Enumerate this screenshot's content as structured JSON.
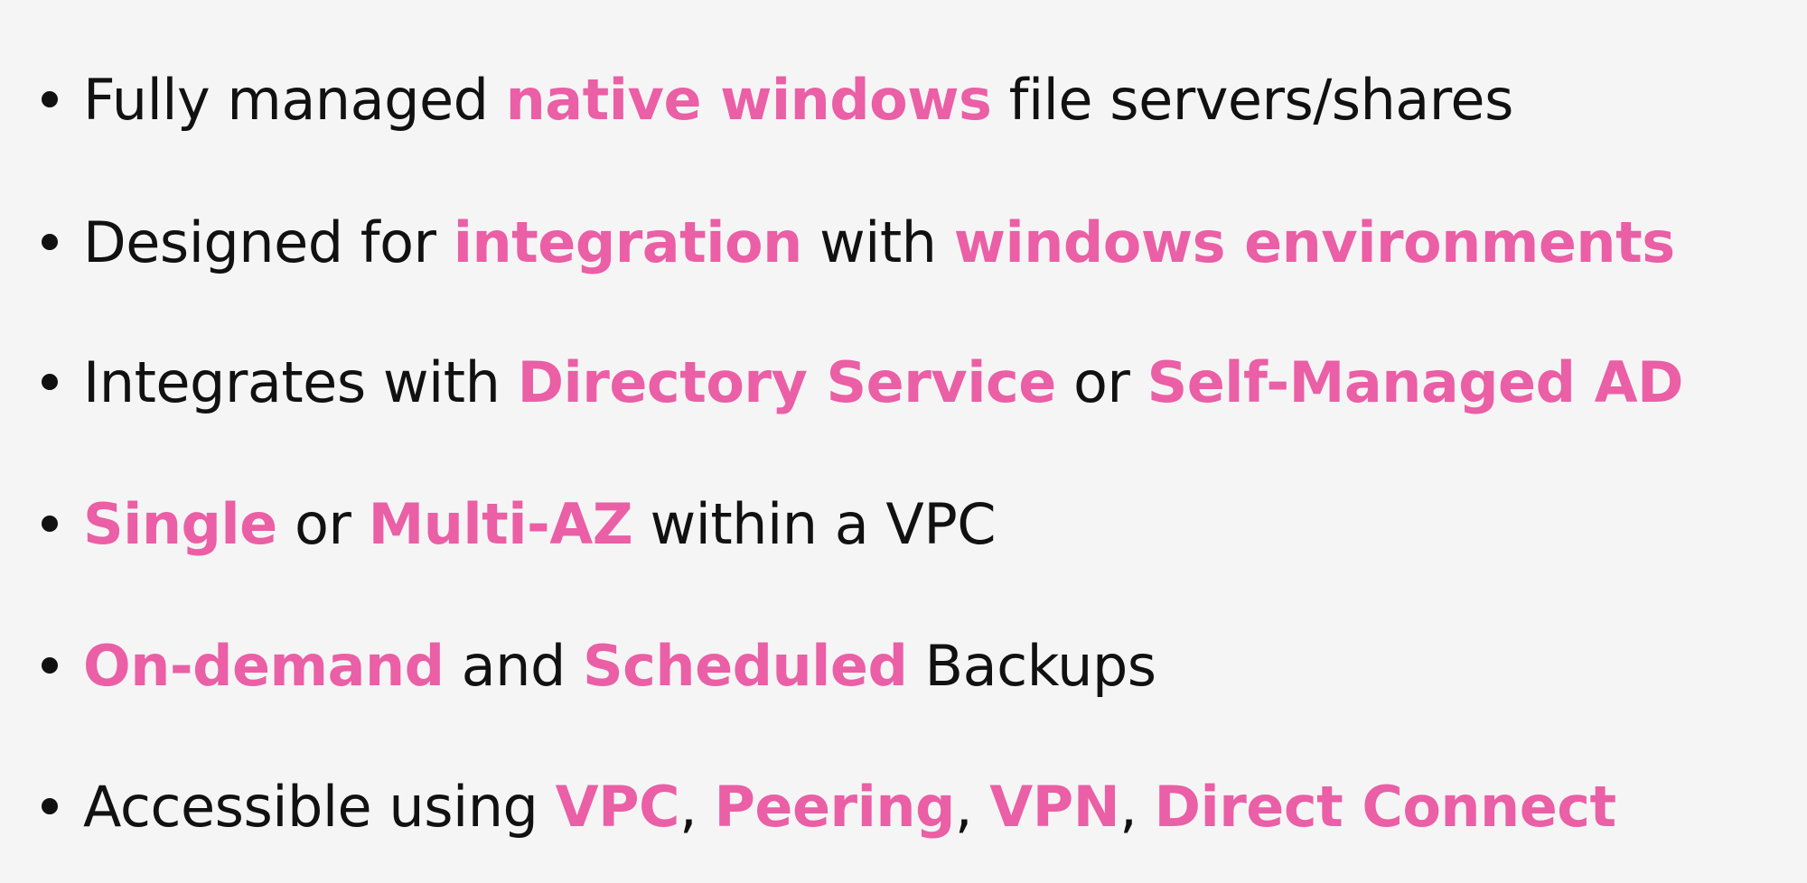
{
  "colors": {
    "background": "#f5f5f5",
    "text": "#111111",
    "highlight": "#ea5fa5"
  },
  "bullets": [
    {
      "segments": [
        {
          "text": "Fully managed ",
          "highlight": false
        },
        {
          "text": "native windows",
          "highlight": true
        },
        {
          "text": " file servers/shares",
          "highlight": false
        }
      ]
    },
    {
      "segments": [
        {
          "text": "Designed for ",
          "highlight": false
        },
        {
          "text": "integration",
          "highlight": true
        },
        {
          "text": " with ",
          "highlight": false
        },
        {
          "text": "windows environments",
          "highlight": true
        }
      ]
    },
    {
      "segments": [
        {
          "text": "Integrates with ",
          "highlight": false
        },
        {
          "text": "Directory Service",
          "highlight": true
        },
        {
          "text": " or ",
          "highlight": false
        },
        {
          "text": "Self-Managed AD",
          "highlight": true
        }
      ]
    },
    {
      "segments": [
        {
          "text": "Single",
          "highlight": true
        },
        {
          "text": " or ",
          "highlight": false
        },
        {
          "text": "Multi-AZ",
          "highlight": true
        },
        {
          "text": " within a VPC",
          "highlight": false
        }
      ]
    },
    {
      "segments": [
        {
          "text": "On-demand",
          "highlight": true
        },
        {
          "text": " and ",
          "highlight": false
        },
        {
          "text": "Scheduled",
          "highlight": true
        },
        {
          "text": " Backups",
          "highlight": false
        }
      ]
    },
    {
      "segments": [
        {
          "text": "Accessible using ",
          "highlight": false
        },
        {
          "text": "VPC",
          "highlight": true
        },
        {
          "text": ", ",
          "highlight": false
        },
        {
          "text": "Peering",
          "highlight": true
        },
        {
          "text": ", ",
          "highlight": false
        },
        {
          "text": "VPN",
          "highlight": true
        },
        {
          "text": ", ",
          "highlight": false
        },
        {
          "text": "Direct Connect",
          "highlight": true
        }
      ]
    }
  ]
}
